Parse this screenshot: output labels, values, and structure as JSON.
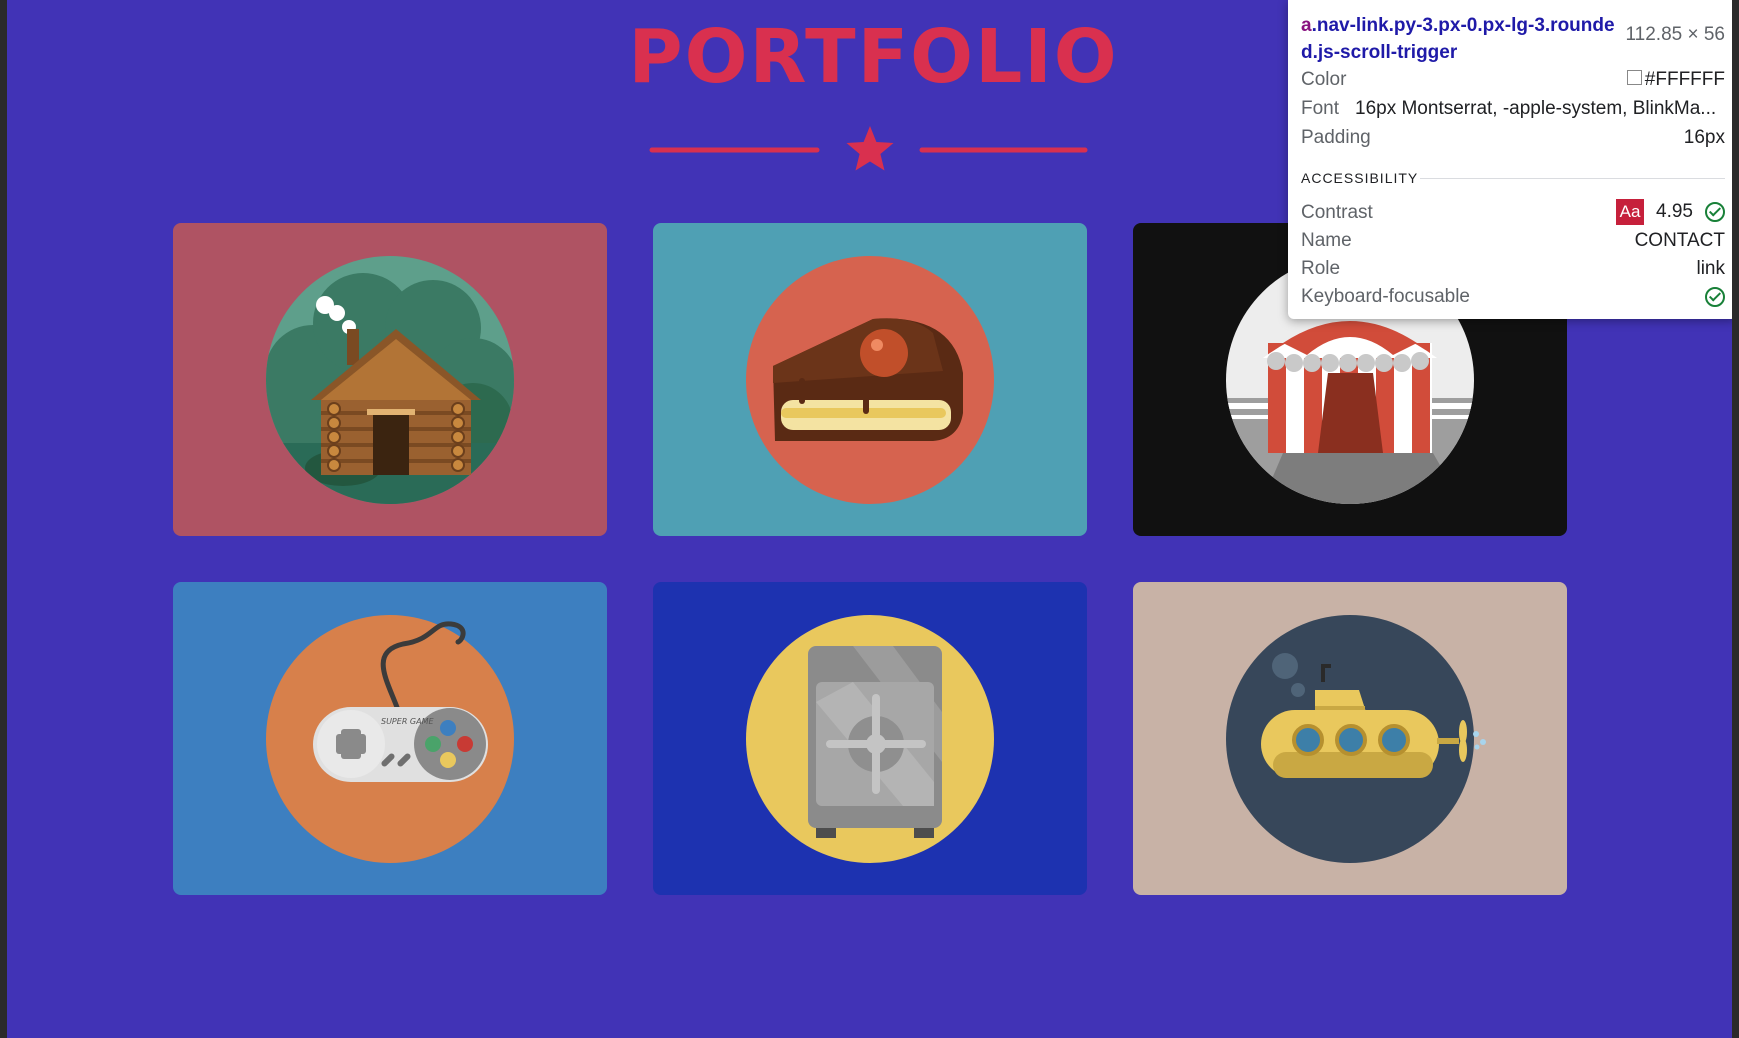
{
  "section": {
    "title": "PORTFOLIO"
  },
  "colors": {
    "background": "#4133b6",
    "accent": "#d9304f"
  },
  "portfolio_items": [
    {
      "name": "log-cabin",
      "card_color": "#af5363",
      "circle_color": "#5e9f8b"
    },
    {
      "name": "cake",
      "card_color": "#4fa0b4",
      "circle_color": "#d6634f"
    },
    {
      "name": "circus-tent",
      "card_color": "#111111",
      "circle_color": "#ededed"
    },
    {
      "name": "game-controller",
      "card_color": "#3d7fc0",
      "circle_color": "#d7804b"
    },
    {
      "name": "safe",
      "card_color": "#1d32b0",
      "circle_color": "#e9c85d"
    },
    {
      "name": "submarine",
      "card_color": "#c8b2a6",
      "circle_color": "#37475a"
    }
  ],
  "controller_text": "SUPER GAME",
  "inspector": {
    "selector_tag": "a",
    "selector_classes": ".nav-link.py-3.px-0.px-lg-3.rounded.js-scroll-trigger",
    "size": "112.85 × 56",
    "color_label": "Color",
    "color_value": "#FFFFFF",
    "font_label": "Font",
    "font_value": "16px Montserrat, -apple-system, BlinkMa...",
    "padding_label": "Padding",
    "padding_value": "16px",
    "accessibility_heading": "ACCESSIBILITY",
    "contrast_label": "Contrast",
    "contrast_badge": "Aa",
    "contrast_value": "4.95",
    "name_label": "Name",
    "name_value": "CONTACT",
    "role_label": "Role",
    "role_value": "link",
    "focusable_label": "Keyboard-focusable"
  }
}
